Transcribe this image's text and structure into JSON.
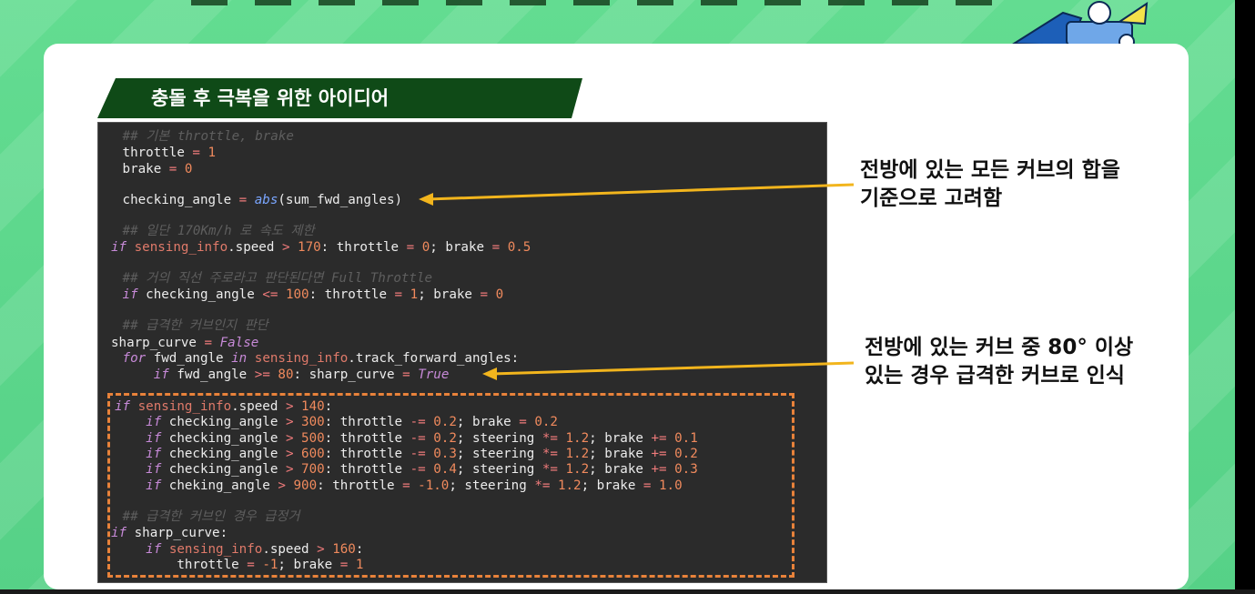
{
  "slide": {
    "title": "충돌 후 극복을 위한 아이디어"
  },
  "code": {
    "lines": [
      {
        "id": "l1",
        "tokens": [
          [
            "cm",
            " ## 기본 throttle, brake"
          ]
        ]
      },
      {
        "id": "l2",
        "tokens": [
          [
            "tx",
            " throttle "
          ],
          [
            "op",
            "="
          ],
          [
            "tx",
            " "
          ],
          [
            "num",
            "1"
          ]
        ]
      },
      {
        "id": "l3",
        "tokens": [
          [
            "tx",
            " brake "
          ],
          [
            "op",
            "="
          ],
          [
            "tx",
            " "
          ],
          [
            "num",
            "0"
          ]
        ]
      },
      {
        "id": "l4",
        "tokens": [
          [
            "tx",
            " checking_angle "
          ],
          [
            "op",
            "="
          ],
          [
            "tx",
            " "
          ],
          [
            "fn",
            "abs"
          ],
          [
            "tx",
            "(sum_fwd_angles)"
          ]
        ]
      },
      {
        "id": "l5",
        "tokens": [
          [
            "cm",
            " ## 일단 170Km/h 로 속도 제한"
          ]
        ]
      },
      {
        "id": "l6",
        "tokens": [
          [
            "kw",
            "if"
          ],
          [
            "tx",
            " "
          ],
          [
            "at",
            "sensing_info"
          ],
          [
            "tx",
            ".speed "
          ],
          [
            "op",
            ">"
          ],
          [
            "tx",
            " "
          ],
          [
            "num",
            "170"
          ],
          [
            "tx",
            ": throttle "
          ],
          [
            "op",
            "="
          ],
          [
            "tx",
            " "
          ],
          [
            "num",
            "0"
          ],
          [
            "tx",
            "; brake "
          ],
          [
            "op",
            "="
          ],
          [
            "tx",
            " "
          ],
          [
            "num",
            "0.5"
          ]
        ]
      },
      {
        "id": "l7",
        "tokens": [
          [
            "cm",
            " ## 거의 직선 주로라고 판단된다면 Full Throttle"
          ]
        ]
      },
      {
        "id": "l8",
        "tokens": [
          [
            "tx",
            " "
          ],
          [
            "kw",
            "if"
          ],
          [
            "tx",
            " checking_angle "
          ],
          [
            "op",
            "<="
          ],
          [
            "tx",
            " "
          ],
          [
            "num",
            "100"
          ],
          [
            "tx",
            ": throttle "
          ],
          [
            "op",
            "="
          ],
          [
            "tx",
            " "
          ],
          [
            "num",
            "1"
          ],
          [
            "tx",
            "; brake "
          ],
          [
            "op",
            "="
          ],
          [
            "tx",
            " "
          ],
          [
            "num",
            "0"
          ]
        ]
      },
      {
        "id": "l9",
        "tokens": [
          [
            "cm",
            " ## 급격한 커브인지 판단"
          ]
        ]
      },
      {
        "id": "l10",
        "tokens": [
          [
            "tx",
            "sharp_curve "
          ],
          [
            "op",
            "="
          ],
          [
            "tx",
            " "
          ],
          [
            "bool",
            "False"
          ]
        ]
      },
      {
        "id": "l11",
        "tokens": [
          [
            "tx",
            " "
          ],
          [
            "kw",
            "for"
          ],
          [
            "tx",
            " fwd_angle "
          ],
          [
            "kw",
            "in"
          ],
          [
            "tx",
            " "
          ],
          [
            "at",
            "sensing_info"
          ],
          [
            "tx",
            ".track_forward_angles:"
          ]
        ]
      },
      {
        "id": "l12",
        "tokens": [
          [
            "tx",
            "     "
          ],
          [
            "kw",
            "if"
          ],
          [
            "tx",
            " fwd_angle "
          ],
          [
            "op",
            ">="
          ],
          [
            "tx",
            " "
          ],
          [
            "num",
            "80"
          ],
          [
            "tx",
            ": sharp_curve "
          ],
          [
            "op",
            "="
          ],
          [
            "tx",
            " "
          ],
          [
            "bool",
            "True"
          ]
        ]
      },
      {
        "id": "l13",
        "tokens": [
          [
            "kw",
            "if"
          ],
          [
            "tx",
            " "
          ],
          [
            "at",
            "sensing_info"
          ],
          [
            "tx",
            ".speed "
          ],
          [
            "op",
            ">"
          ],
          [
            "tx",
            " "
          ],
          [
            "num",
            "140"
          ],
          [
            "tx",
            ":"
          ]
        ]
      },
      {
        "id": "l14",
        "tokens": [
          [
            "tx",
            "    "
          ],
          [
            "kw",
            "if"
          ],
          [
            "tx",
            " checking_angle "
          ],
          [
            "op",
            ">"
          ],
          [
            "tx",
            " "
          ],
          [
            "num",
            "300"
          ],
          [
            "tx",
            ": throttle "
          ],
          [
            "op",
            "-="
          ],
          [
            "tx",
            " "
          ],
          [
            "num",
            "0.2"
          ],
          [
            "tx",
            "; brake "
          ],
          [
            "op",
            "="
          ],
          [
            "tx",
            " "
          ],
          [
            "num",
            "0.2"
          ]
        ]
      },
      {
        "id": "l15",
        "tokens": [
          [
            "tx",
            "    "
          ],
          [
            "kw",
            "if"
          ],
          [
            "tx",
            " checking_angle "
          ],
          [
            "op",
            ">"
          ],
          [
            "tx",
            " "
          ],
          [
            "num",
            "500"
          ],
          [
            "tx",
            ": throttle "
          ],
          [
            "op",
            "-="
          ],
          [
            "tx",
            " "
          ],
          [
            "num",
            "0.2"
          ],
          [
            "tx",
            "; steering "
          ],
          [
            "op",
            "*="
          ],
          [
            "tx",
            " "
          ],
          [
            "num",
            "1.2"
          ],
          [
            "tx",
            "; brake "
          ],
          [
            "op",
            "+="
          ],
          [
            "tx",
            " "
          ],
          [
            "num",
            "0.1"
          ]
        ]
      },
      {
        "id": "l16",
        "tokens": [
          [
            "tx",
            "    "
          ],
          [
            "kw",
            "if"
          ],
          [
            "tx",
            " checking_angle "
          ],
          [
            "op",
            ">"
          ],
          [
            "tx",
            " "
          ],
          [
            "num",
            "600"
          ],
          [
            "tx",
            ": throttle "
          ],
          [
            "op",
            "-="
          ],
          [
            "tx",
            " "
          ],
          [
            "num",
            "0.3"
          ],
          [
            "tx",
            "; steering "
          ],
          [
            "op",
            "*="
          ],
          [
            "tx",
            " "
          ],
          [
            "num",
            "1.2"
          ],
          [
            "tx",
            "; brake "
          ],
          [
            "op",
            "+="
          ],
          [
            "tx",
            " "
          ],
          [
            "num",
            "0.2"
          ]
        ]
      },
      {
        "id": "l17",
        "tokens": [
          [
            "tx",
            "    "
          ],
          [
            "kw",
            "if"
          ],
          [
            "tx",
            " checking_angle "
          ],
          [
            "op",
            ">"
          ],
          [
            "tx",
            " "
          ],
          [
            "num",
            "700"
          ],
          [
            "tx",
            ": throttle "
          ],
          [
            "op",
            "-="
          ],
          [
            "tx",
            " "
          ],
          [
            "num",
            "0.4"
          ],
          [
            "tx",
            "; steering "
          ],
          [
            "op",
            "*="
          ],
          [
            "tx",
            " "
          ],
          [
            "num",
            "1.2"
          ],
          [
            "tx",
            "; brake "
          ],
          [
            "op",
            "+="
          ],
          [
            "tx",
            " "
          ],
          [
            "num",
            "0.3"
          ]
        ]
      },
      {
        "id": "l18",
        "tokens": [
          [
            "tx",
            "    "
          ],
          [
            "kw",
            "if"
          ],
          [
            "tx",
            " cheking_angle "
          ],
          [
            "op",
            ">"
          ],
          [
            "tx",
            " "
          ],
          [
            "num",
            "900"
          ],
          [
            "tx",
            ": throttle "
          ],
          [
            "op",
            "="
          ],
          [
            "tx",
            " "
          ],
          [
            "num",
            "-1.0"
          ],
          [
            "tx",
            "; steering "
          ],
          [
            "op",
            "*="
          ],
          [
            "tx",
            " "
          ],
          [
            "num",
            "1.2"
          ],
          [
            "tx",
            "; brake "
          ],
          [
            "op",
            "="
          ],
          [
            "tx",
            " "
          ],
          [
            "num",
            "1.0"
          ]
        ]
      },
      {
        "id": "l19",
        "tokens": [
          [
            "cm",
            " ## 급격한 커브인 경우 급정거"
          ]
        ]
      },
      {
        "id": "l20",
        "tokens": [
          [
            "kw",
            "if"
          ],
          [
            "tx",
            " sharp_curve:"
          ]
        ]
      },
      {
        "id": "l21",
        "tokens": [
          [
            "tx",
            "    "
          ],
          [
            "kw",
            "if"
          ],
          [
            "tx",
            " "
          ],
          [
            "at",
            "sensing_info"
          ],
          [
            "tx",
            ".speed "
          ],
          [
            "op",
            ">"
          ],
          [
            "tx",
            " "
          ],
          [
            "num",
            "160"
          ],
          [
            "tx",
            ":"
          ]
        ]
      },
      {
        "id": "l22",
        "tokens": [
          [
            "tx",
            "        throttle "
          ],
          [
            "op",
            "="
          ],
          [
            "tx",
            " "
          ],
          [
            "num",
            "-1"
          ],
          [
            "tx",
            "; brake "
          ],
          [
            "op",
            "="
          ],
          [
            "tx",
            " "
          ],
          [
            "num",
            "1"
          ]
        ]
      }
    ]
  },
  "annotations": {
    "first": {
      "line1": "전방에 있는 모든 커브의 합을",
      "line2": "기준으로 고려함"
    },
    "second": {
      "line1": "전방에 있는 커브 중 80° 이상",
      "line2": "있는 경우 급격한 커브로 인식"
    }
  },
  "colors": {
    "background_green": "#5cd68a",
    "banner_green": "#0f4a17",
    "code_bg": "#2b2b2b",
    "dashed_orange": "#e8823a",
    "arrow_yellow": "#f2b51d"
  }
}
